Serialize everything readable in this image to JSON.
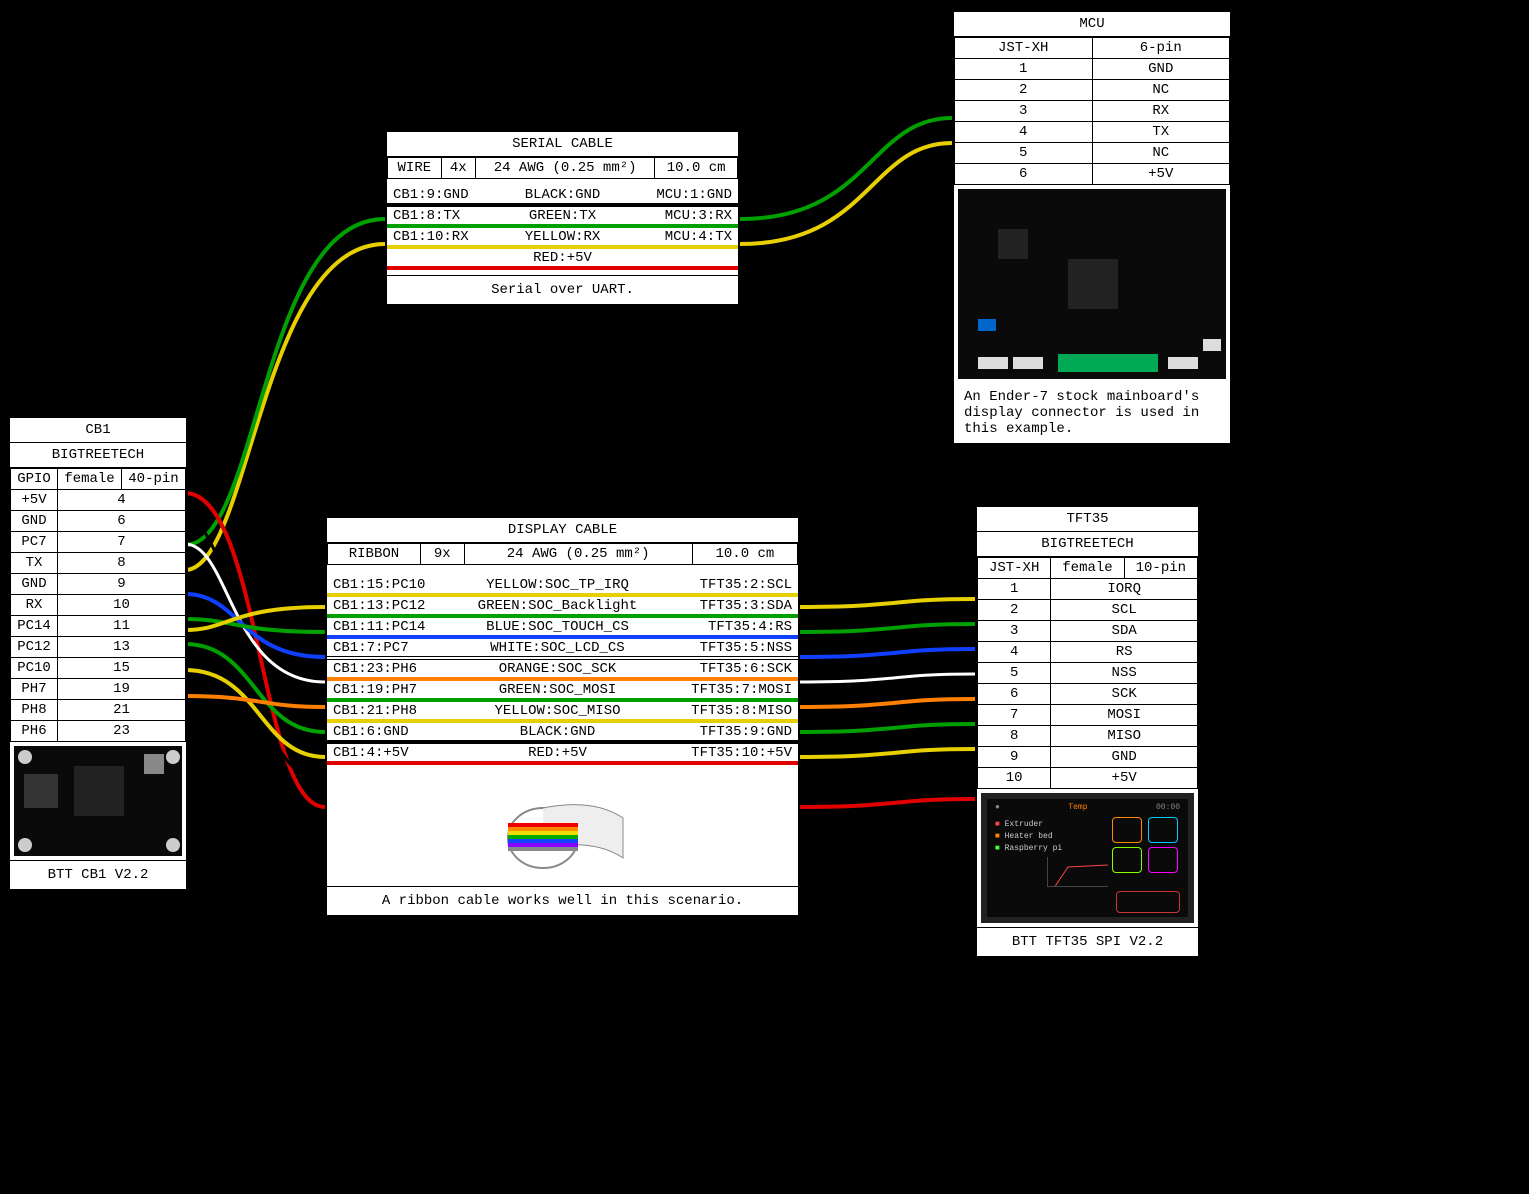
{
  "cb1": {
    "title": "CB1",
    "subtitle": "BIGTREETECH",
    "headers": [
      "GPIO",
      "female",
      "40-pin"
    ],
    "pins": [
      {
        "gpio": "+5V",
        "pin": "4"
      },
      {
        "gpio": "GND",
        "pin": "6"
      },
      {
        "gpio": "PC7",
        "pin": "7"
      },
      {
        "gpio": "TX",
        "pin": "8"
      },
      {
        "gpio": "GND",
        "pin": "9"
      },
      {
        "gpio": "RX",
        "pin": "10"
      },
      {
        "gpio": "PC14",
        "pin": "11"
      },
      {
        "gpio": "PC12",
        "pin": "13"
      },
      {
        "gpio": "PC10",
        "pin": "15"
      },
      {
        "gpio": "PH7",
        "pin": "19"
      },
      {
        "gpio": "PH8",
        "pin": "21"
      },
      {
        "gpio": "PH6",
        "pin": "23"
      }
    ],
    "img_label": "BTT CB1 V2.2"
  },
  "mcu": {
    "title": "MCU",
    "headers": [
      "JST-XH",
      "",
      "6-pin"
    ],
    "pins": [
      {
        "n": "1",
        "name": "GND"
      },
      {
        "n": "2",
        "name": "NC"
      },
      {
        "n": "3",
        "name": "RX"
      },
      {
        "n": "4",
        "name": "TX"
      },
      {
        "n": "5",
        "name": "NC"
      },
      {
        "n": "6",
        "name": "+5V"
      }
    ],
    "caption": "An Ender-7 stock mainboard's display connector is used in this example."
  },
  "tft35": {
    "title": "TFT35",
    "subtitle": "BIGTREETECH",
    "headers": [
      "JST-XH",
      "female",
      "10-pin"
    ],
    "pins": [
      {
        "n": "1",
        "name": "IORQ"
      },
      {
        "n": "2",
        "name": "SCL"
      },
      {
        "n": "3",
        "name": "SDA"
      },
      {
        "n": "4",
        "name": "RS"
      },
      {
        "n": "5",
        "name": "NSS"
      },
      {
        "n": "6",
        "name": "SCK"
      },
      {
        "n": "7",
        "name": "MOSI"
      },
      {
        "n": "8",
        "name": "MISO"
      },
      {
        "n": "9",
        "name": "GND"
      },
      {
        "n": "10",
        "name": "+5V"
      }
    ],
    "img_label": "BTT TFT35 SPI V2.2"
  },
  "serial_cable": {
    "title": "SERIAL CABLE",
    "spec": [
      "WIRE",
      "4x",
      "24 AWG (0.25 mm²)",
      "10.0 cm"
    ],
    "wires": [
      {
        "left": "CB1:9:GND",
        "mid": "BLACK:GND",
        "right": "MCU:1:GND",
        "color": "#000"
      },
      {
        "left": "CB1:8:TX",
        "mid": "GREEN:TX",
        "right": "MCU:3:RX",
        "color": "#00a000"
      },
      {
        "left": "CB1:10:RX",
        "mid": "YELLOW:RX",
        "right": "MCU:4:TX",
        "color": "#e8d000"
      },
      {
        "left": "",
        "mid": "RED:+5V",
        "right": "",
        "color": "#e00000"
      }
    ],
    "caption": "Serial over UART."
  },
  "display_cable": {
    "title": "DISPLAY CABLE",
    "spec": [
      "RIBBON",
      "9x",
      "24 AWG (0.25 mm²)",
      "10.0 cm"
    ],
    "wires": [
      {
        "left": "CB1:15:PC10",
        "mid": "YELLOW:SOC_TP_IRQ",
        "right": "TFT35:2:SCL",
        "color": "#e8d000"
      },
      {
        "left": "CB1:13:PC12",
        "mid": "GREEN:SOC_Backlight",
        "right": "TFT35:3:SDA",
        "color": "#00a000"
      },
      {
        "left": "CB1:11:PC14",
        "mid": "BLUE:SOC_TOUCH_CS",
        "right": "TFT35:4:RS",
        "color": "#1040ff"
      },
      {
        "left": "CB1:7:PC7",
        "mid": "WHITE:SOC_LCD_CS",
        "right": "TFT35:5:NSS",
        "color": "#fff"
      },
      {
        "left": "CB1:23:PH6",
        "mid": "ORANGE:SOC_SCK",
        "right": "TFT35:6:SCK",
        "color": "#ff8000"
      },
      {
        "left": "CB1:19:PH7",
        "mid": "GREEN:SOC_MOSI",
        "right": "TFT35:7:MOSI",
        "color": "#00a000"
      },
      {
        "left": "CB1:21:PH8",
        "mid": "YELLOW:SOC_MISO",
        "right": "TFT35:8:MISO",
        "color": "#e8d000"
      },
      {
        "left": "CB1:6:GND",
        "mid": "BLACK:GND",
        "right": "TFT35:9:GND",
        "color": "#000"
      },
      {
        "left": "CB1:4:+5V",
        "mid": "RED:+5V",
        "right": "TFT35:10:+5V",
        "color": "#e00000"
      }
    ],
    "caption": "A ribbon cable works well in this scenario."
  },
  "colors": {
    "black": "#000",
    "green": "#00a000",
    "yellow": "#e8d000",
    "red": "#e00000",
    "blue": "#1040ff",
    "white": "#fff",
    "orange": "#ff8000"
  }
}
